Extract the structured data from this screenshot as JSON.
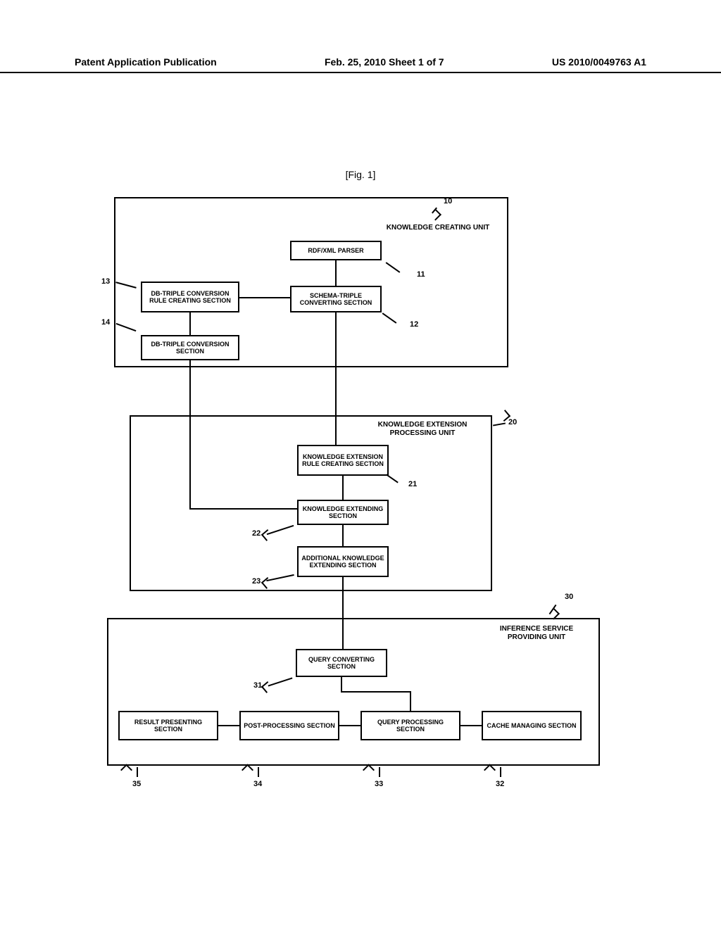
{
  "header": {
    "left": "Patent Application Publication",
    "middle": "Feb. 25, 2010  Sheet 1 of 7",
    "right": "US 2010/0049763 A1"
  },
  "figure_label": "[Fig. 1]",
  "units": {
    "u10": {
      "num": "10",
      "label": "KNOWLEDGE CREATING UNIT",
      "b11": {
        "num": "11",
        "label": "RDF/XML PARSER"
      },
      "b12": {
        "num": "12",
        "label": "SCHEMA-TRIPLE CONVERTING SECTION"
      },
      "b13": {
        "num": "13",
        "label": "DB-TRIPLE CONVERSION RULE CREATING SECTION"
      },
      "b14": {
        "num": "14",
        "label": "DB-TRIPLE CONVERSION SECTION"
      }
    },
    "u20": {
      "num": "20",
      "label": "KNOWLEDGE EXTENSION PROCESSING UNIT",
      "b21": {
        "num": "21",
        "label": "KNOWLEDGE EXTENSION RULE CREATING SECTION"
      },
      "b22": {
        "num": "22",
        "label": "KNOWLEDGE EXTENDING SECTION"
      },
      "b23": {
        "num": "23",
        "label": "ADDITIONAL KNOWLEDGE EXTENDING SECTION"
      }
    },
    "u30": {
      "num": "30",
      "label": "INFERENCE SERVICE PROVIDING UNIT",
      "b31": {
        "num": "31",
        "label": "QUERY CONVERTING SECTION"
      },
      "b32": {
        "num": "32",
        "label": "CACHE MANAGING SECTION"
      },
      "b33": {
        "num": "33",
        "label": "QUERY PROCESSING SECTION"
      },
      "b34": {
        "num": "34",
        "label": "POST-PROCESSING SECTION"
      },
      "b35": {
        "num": "35",
        "label": "RESULT PRESENTING SECTION"
      }
    }
  }
}
